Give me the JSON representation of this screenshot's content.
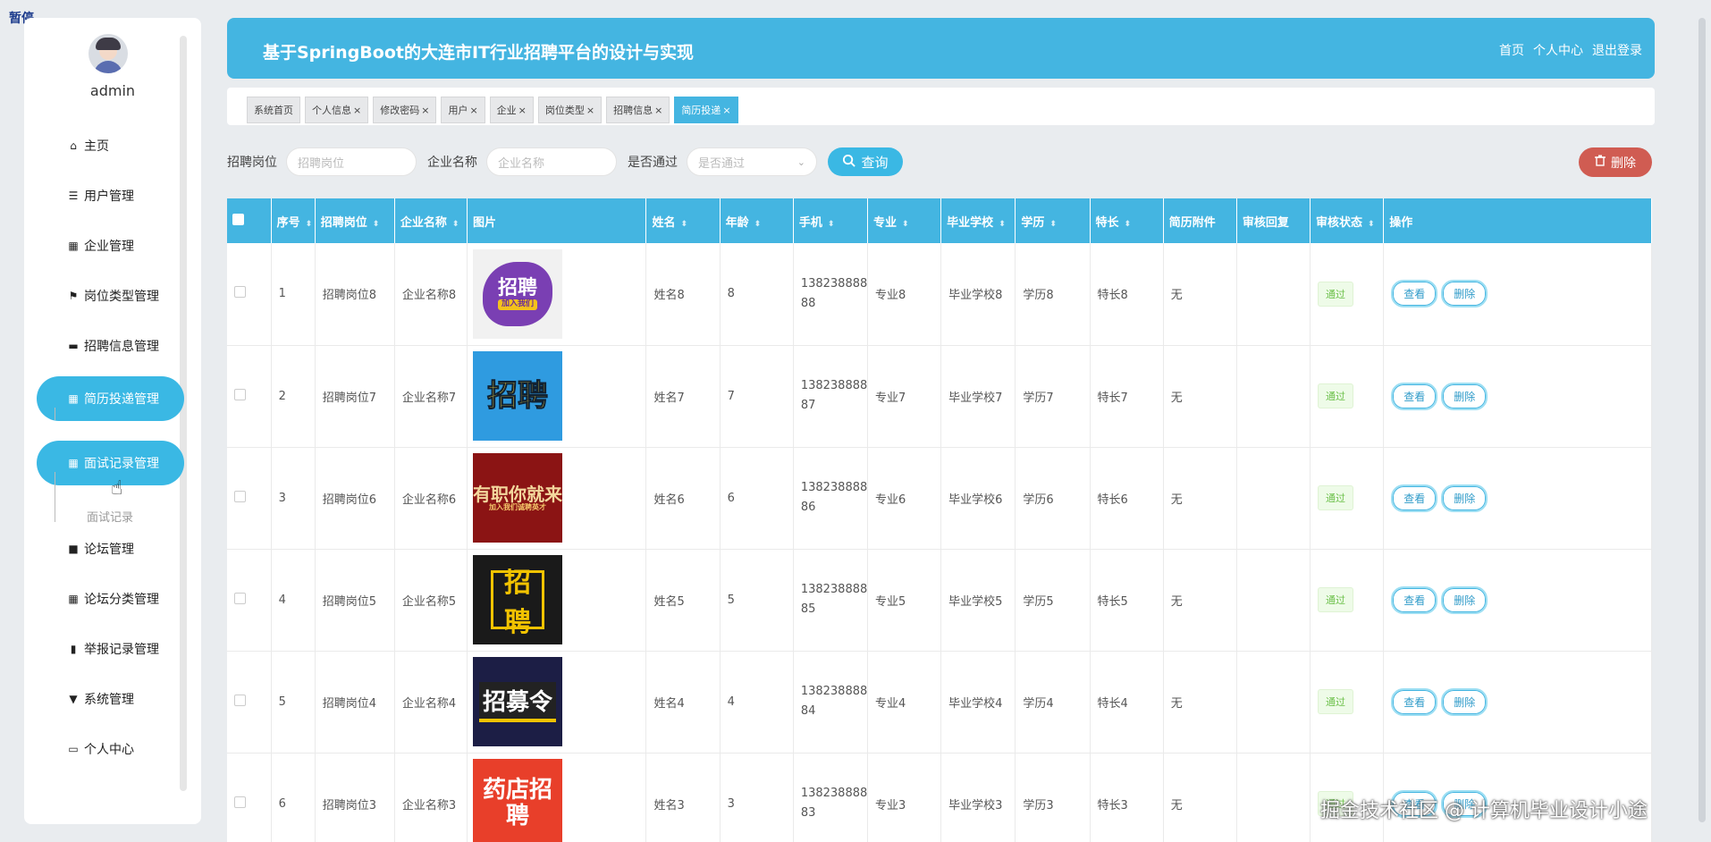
{
  "overlay": {
    "pause_label": "暂停"
  },
  "sidebar": {
    "username": "admin",
    "items": [
      {
        "label": "主页",
        "icon": "home-icon",
        "glyph": "⌂"
      },
      {
        "label": "用户管理",
        "icon": "list-icon",
        "glyph": "☰"
      },
      {
        "label": "企业管理",
        "icon": "grid-icon",
        "glyph": "▦"
      },
      {
        "label": "岗位类型管理",
        "icon": "flag-icon",
        "glyph": "⚑"
      },
      {
        "label": "招聘信息管理",
        "icon": "ticket-icon",
        "glyph": "▬"
      },
      {
        "label": "简历投递管理",
        "icon": "grid-icon",
        "glyph": "▦"
      },
      {
        "label": "面试记录管理",
        "icon": "grid-icon",
        "glyph": "▦"
      },
      {
        "label": "论坛管理",
        "icon": "briefcase-icon",
        "glyph": "■"
      },
      {
        "label": "论坛分类管理",
        "icon": "grid-icon",
        "glyph": "▦"
      },
      {
        "label": "举报记录管理",
        "icon": "book-icon",
        "glyph": "▮"
      },
      {
        "label": "系统管理",
        "icon": "pin-icon",
        "glyph": "▼"
      },
      {
        "label": "个人中心",
        "icon": "card-icon",
        "glyph": "▭"
      }
    ],
    "sub_item": "面试记录"
  },
  "header": {
    "title": "基于SpringBoot的大连市IT行业招聘平台的设计与实现",
    "links": [
      "首页",
      "个人中心",
      "退出登录"
    ]
  },
  "tabs": [
    {
      "label": "系统首页",
      "closable": false
    },
    {
      "label": "个人信息",
      "closable": true
    },
    {
      "label": "修改密码",
      "closable": true
    },
    {
      "label": "用户",
      "closable": true
    },
    {
      "label": "企业",
      "closable": true
    },
    {
      "label": "岗位类型",
      "closable": true
    },
    {
      "label": "招聘信息",
      "closable": true
    },
    {
      "label": "简历投递",
      "closable": true
    }
  ],
  "search": {
    "job_label": "招聘岗位",
    "job_placeholder": "招聘岗位",
    "company_label": "企业名称",
    "company_placeholder": "企业名称",
    "pass_label": "是否通过",
    "pass_placeholder": "是否通过",
    "query_button": "查询",
    "delete_button": "删除"
  },
  "table": {
    "columns": [
      "序号",
      "招聘岗位",
      "企业名称",
      "图片",
      "姓名",
      "年龄",
      "手机",
      "专业",
      "毕业学校",
      "学历",
      "特长",
      "简历附件",
      "审核回复",
      "审核状态",
      "操作"
    ],
    "view_label": "查看",
    "delete_label": "删除",
    "rows": [
      {
        "index": "1",
        "job": "招聘岗位8",
        "company": "企业名称8",
        "poster": "p1",
        "poster_text": "招聘",
        "poster_sub": "加入我们",
        "name": "姓名8",
        "age": "8",
        "phone": "13823888888",
        "major": "专业8",
        "school": "毕业学校8",
        "edu": "学历8",
        "skill": "特长8",
        "attach": "无",
        "reply": "",
        "status": "通过"
      },
      {
        "index": "2",
        "job": "招聘岗位7",
        "company": "企业名称7",
        "poster": "p2",
        "poster_text": "招聘",
        "poster_sub": "",
        "name": "姓名7",
        "age": "7",
        "phone": "13823888887",
        "major": "专业7",
        "school": "毕业学校7",
        "edu": "学历7",
        "skill": "特长7",
        "attach": "无",
        "reply": "",
        "status": "通过"
      },
      {
        "index": "3",
        "job": "招聘岗位6",
        "company": "企业名称6",
        "poster": "p3",
        "poster_text": "有职你就来",
        "poster_sub": "加入我们诚聘英才",
        "name": "姓名6",
        "age": "6",
        "phone": "13823888886",
        "major": "专业6",
        "school": "毕业学校6",
        "edu": "学历6",
        "skill": "特长6",
        "attach": "无",
        "reply": "",
        "status": "通过"
      },
      {
        "index": "4",
        "job": "招聘岗位5",
        "company": "企业名称5",
        "poster": "p4",
        "poster_text": "招聘",
        "poster_sub": "",
        "name": "姓名5",
        "age": "5",
        "phone": "13823888885",
        "major": "专业5",
        "school": "毕业学校5",
        "edu": "学历5",
        "skill": "特长5",
        "attach": "无",
        "reply": "",
        "status": "通过"
      },
      {
        "index": "5",
        "job": "招聘岗位4",
        "company": "企业名称4",
        "poster": "p5",
        "poster_text": "招募令",
        "poster_sub": "",
        "name": "姓名4",
        "age": "4",
        "phone": "13823888884",
        "major": "专业4",
        "school": "毕业学校4",
        "edu": "学历4",
        "skill": "特长4",
        "attach": "无",
        "reply": "",
        "status": "通过"
      },
      {
        "index": "6",
        "job": "招聘岗位3",
        "company": "企业名称3",
        "poster": "p6",
        "poster_text": "药店招聘",
        "poster_sub": "",
        "name": "姓名3",
        "age": "3",
        "phone": "13823888883",
        "major": "专业3",
        "school": "毕业学校3",
        "edu": "学历3",
        "skill": "特长3",
        "attach": "无",
        "reply": "",
        "status": "通过"
      }
    ]
  },
  "watermark": "掘金技术社区 @ 计算机毕业设计小途",
  "colors": {
    "accent": "#44b5e1",
    "danger": "#d05c52",
    "success": "#6cc04a"
  }
}
